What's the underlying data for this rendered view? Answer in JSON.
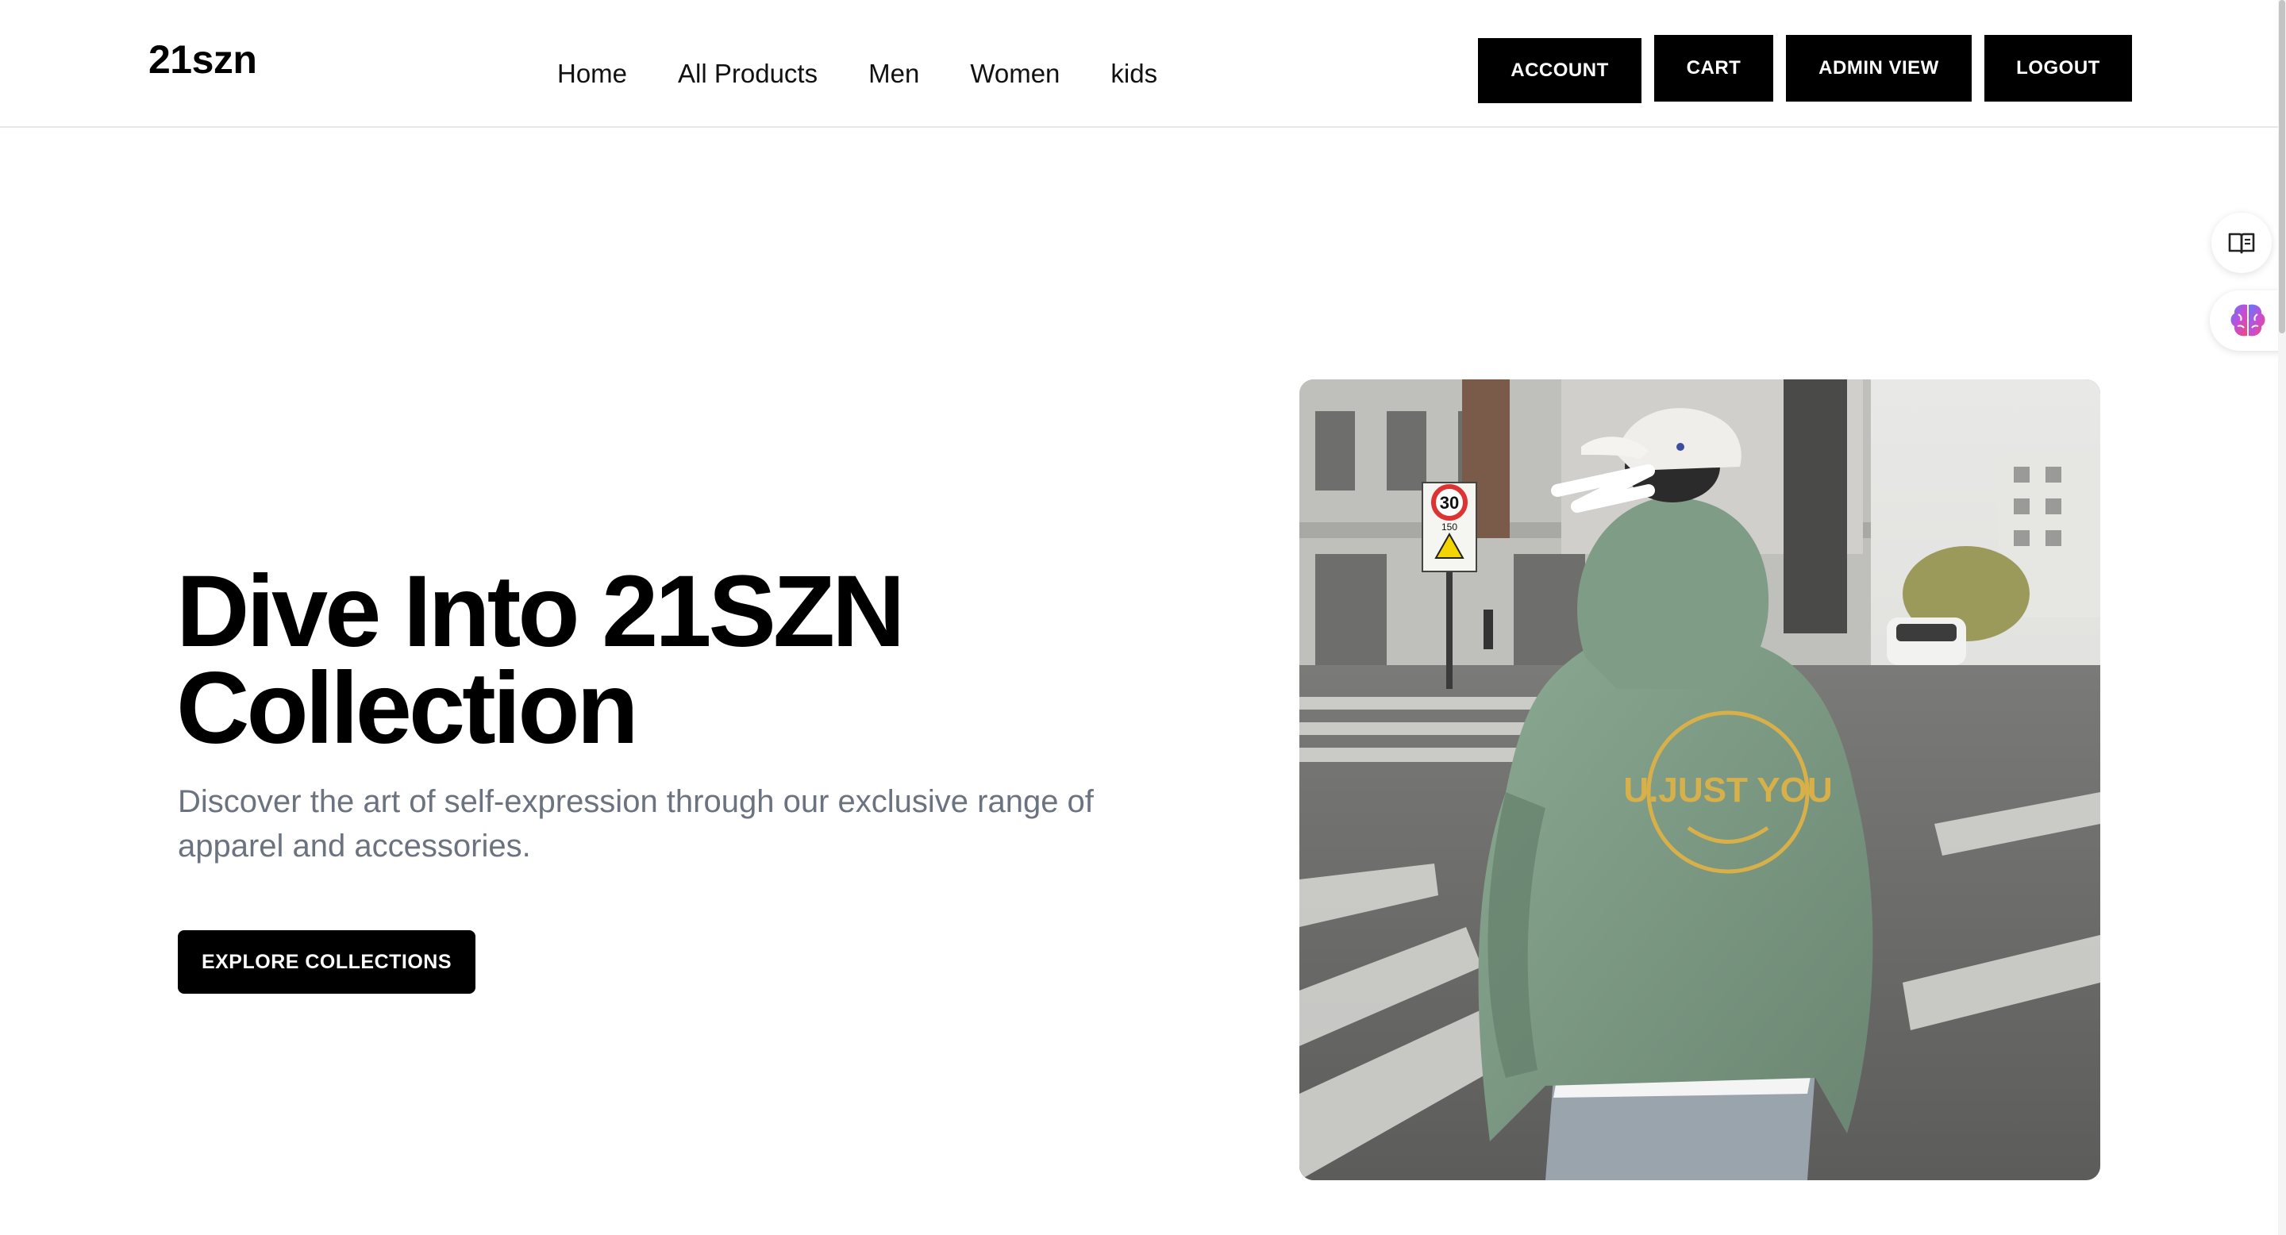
{
  "header": {
    "logo": "21szn",
    "nav": [
      {
        "label": "Home"
      },
      {
        "label": "All Products"
      },
      {
        "label": "Men"
      },
      {
        "label": "Women"
      },
      {
        "label": "kids"
      }
    ],
    "actions": {
      "account": "ACCOUNT",
      "cart": "CART",
      "admin": "ADMIN VIEW",
      "logout": "LOGOUT"
    }
  },
  "hero": {
    "title_line1": "Dive Into 21SZN",
    "title_line2": "Collection",
    "subtitle": "Discover the art of self-expression through our exclusive range of apparel and accessories.",
    "cta": "EXPLORE COLLECTIONS",
    "image": {
      "hoodie_print": "U.JUST YOU",
      "speed_sign": "30",
      "sign_sub": "150",
      "description_icon": "photo-hoodie-model"
    }
  },
  "side_widgets": [
    {
      "icon": "book-reader-icon"
    },
    {
      "icon": "brain-icon"
    }
  ],
  "colors": {
    "primary": "#000000",
    "text_muted": "#6b7280",
    "border": "#e5e7eb",
    "hoodie": "#7e9b86",
    "print": "#d8b04a"
  }
}
